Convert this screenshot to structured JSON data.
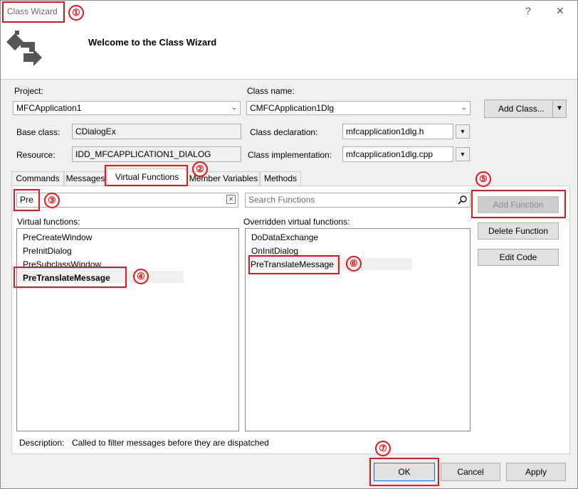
{
  "window": {
    "title": "Class Wizard",
    "help_glyph": "?",
    "close_glyph": "✕"
  },
  "header": {
    "welcome": "Welcome to the Class Wizard"
  },
  "fields": {
    "project_label": "Project:",
    "project_value": "MFCApplication1",
    "classname_label": "Class name:",
    "classname_value": "CMFCApplication1Dlg",
    "add_class_label": "Add Class...",
    "baseclass_label": "Base class:",
    "baseclass_value": "CDialogEx",
    "classdecl_label": "Class declaration:",
    "classdecl_value": "mfcapplication1dlg.h",
    "resource_label": "Resource:",
    "resource_value": "IDD_MFCAPPLICATION1_DIALOG",
    "classimpl_label": "Class implementation:",
    "classimpl_value": "mfcapplication1dlg.cpp"
  },
  "tabs": [
    "Commands",
    "Messages",
    "Virtual Functions",
    "Member Variables",
    "Methods"
  ],
  "filter": {
    "value": "Pre",
    "clear_glyph": "✕"
  },
  "search": {
    "placeholder": "Search Functions"
  },
  "virtual_functions": {
    "label": "Virtual functions:",
    "items": [
      "PreCreateWindow",
      "PreInitDialog",
      "PreSubclassWindow",
      "PreTranslateMessage"
    ]
  },
  "overridden_functions": {
    "label": "Overridden virtual functions:",
    "items": [
      "DoDataExchange",
      "OnInitDialog",
      "PreTranslateMessage"
    ]
  },
  "side_buttons": {
    "add_function": "Add Function",
    "delete_function": "Delete Function",
    "edit_code": "Edit Code"
  },
  "description": {
    "label": "Description:",
    "text": "Called to filter messages before they are dispatched"
  },
  "footer_buttons": {
    "ok": "OK",
    "cancel": "Cancel",
    "apply": "Apply"
  },
  "callouts": [
    "①",
    "②",
    "③",
    "④",
    "⑤",
    "⑥",
    "⑦"
  ],
  "colors": {
    "highlight_red": "#e8141e"
  }
}
